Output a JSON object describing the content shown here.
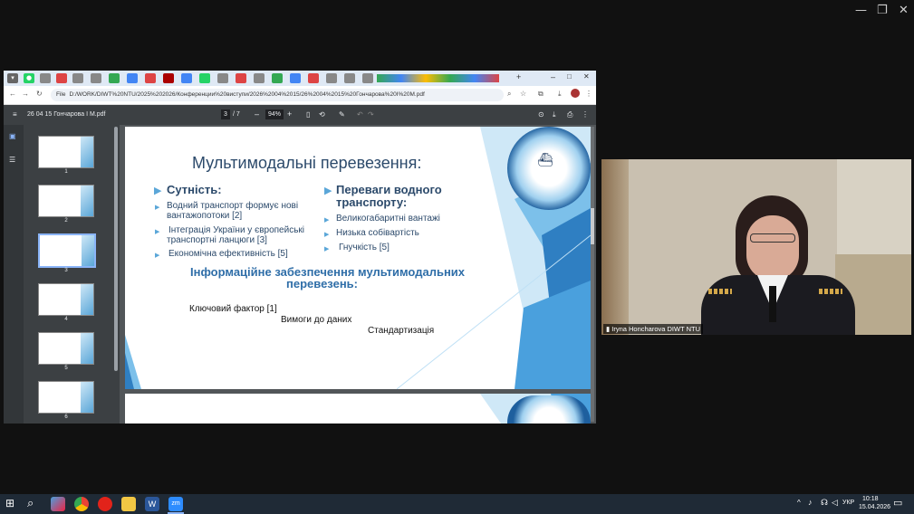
{
  "browser": {
    "url": "D:/WORK/DIWT%20NTU/2025%202026/Конференции%20виступи/2026%2004%2015/26%2004%2015%20Гончарова%20I%20M.pdf",
    "url_prefix": "File"
  },
  "pdf": {
    "filename": "26 04 15 Гончарова I M.pdf",
    "page_current": "3",
    "page_total": "/ 7",
    "zoom": "94%"
  },
  "thumbnails": [
    "1",
    "2",
    "3",
    "4",
    "5",
    "6"
  ],
  "slide": {
    "title": "Мультимодальні перевезення:",
    "left_heading": "Сутність:",
    "left_items": [
      "Водний транспорт формує нові",
      "вантажопотоки [2]",
      "Інтеграція України у європейські",
      "транспортні ланцюги [3]",
      "Економічна ефективність [5]"
    ],
    "right_heading_1": "Переваги водного",
    "right_heading_2": "транспорту:",
    "right_items": [
      "Великогабаритні вантажі",
      "Низька собівартість",
      "Гнучкість [5]"
    ],
    "info_line1": "Інформаційне забезпечення мультимодальних",
    "info_line2": "перевезень:",
    "key_factor": "Ключовий фактор [1]",
    "data_req": "Вимоги до даних",
    "standard": "Стандартизація"
  },
  "video": {
    "participant": "Iryna Honcharova DIWT NTU"
  },
  "taskbar": {
    "lang": "УКР",
    "time": "10:18",
    "date": "15.04.2026"
  },
  "colors": {
    "accent": "#5aa6d8",
    "slide_text": "#2c4a6b",
    "taskbar": "#1f2a36"
  }
}
